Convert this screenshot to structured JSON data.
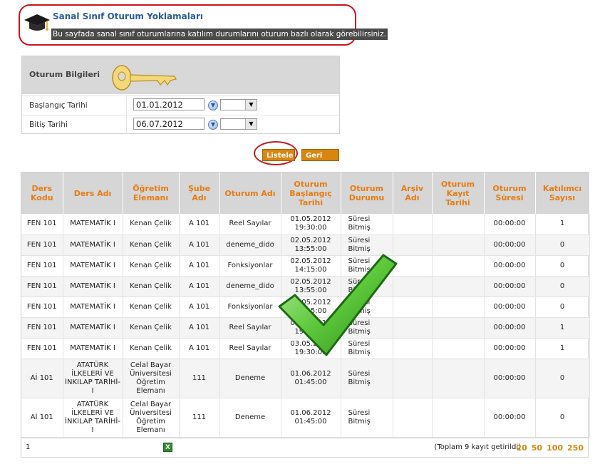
{
  "header": {
    "title": "Sanal Sınıf Oturum Yoklamaları",
    "description": "Bu sayfada sanal sınıf oturumlarına katılım durumlarını oturum bazlı olarak görebilirsiniz."
  },
  "form": {
    "title": "Oturum Bilgileri",
    "start_label": "Başlangıç Tarihi",
    "start_value": "01.01.2012",
    "end_label": "Bitiş Tarihi",
    "end_value": "06.07.2012"
  },
  "buttons": {
    "list": "Listele",
    "back": "Geri Dön"
  },
  "table": {
    "headers": [
      "Ders Kodu",
      "Ders Adı",
      "Öğretim Elemanı",
      "Şube Adı",
      "Oturum Adı",
      "Oturum Başlangıç Tarihi",
      "Oturum Durumu",
      "Arşiv Adı",
      "Oturum Kayıt Tarihi",
      "Oturum Süresi",
      "Katılımcı Sayısı"
    ],
    "rows": [
      {
        "code": "FEN 101",
        "course": "MATEMATİK I",
        "instructor": "Kenan Çelik",
        "branch": "A 101",
        "session": "Reel Sayılar",
        "start": "01.05.2012 19:30:00",
        "status": "Süresi Bitmiş",
        "archive": "",
        "record": "",
        "duration": "00:00:00",
        "count": "1"
      },
      {
        "code": "FEN 101",
        "course": "MATEMATİK I",
        "instructor": "Kenan Çelik",
        "branch": "A 101",
        "session": "deneme_dido",
        "start": "02.05.2012 13:55:00",
        "status": "Süresi Bitmiş",
        "archive": "",
        "record": "",
        "duration": "00:00:00",
        "count": "0"
      },
      {
        "code": "FEN 101",
        "course": "MATEMATİK I",
        "instructor": "Kenan Çelik",
        "branch": "A 101",
        "session": "Fonksiyonlar",
        "start": "02.05.2012 14:15:00",
        "status": "Süresi Bitmiş",
        "archive": "",
        "record": "",
        "duration": "00:00:00",
        "count": "0"
      },
      {
        "code": "FEN 101",
        "course": "MATEMATİK I",
        "instructor": "Kenan Çelik",
        "branch": "A 101",
        "session": "deneme_dido",
        "start": "02.05.2012 13:55:00",
        "status": "Süresi Bitmiş",
        "archive": "",
        "record": "",
        "duration": "00:00:00",
        "count": "0"
      },
      {
        "code": "FEN 101",
        "course": "MATEMATİK I",
        "instructor": "Kenan Çelik",
        "branch": "A 101",
        "session": "Fonksiyonlar",
        "start": "02.05.2012 14:15:00",
        "status": "Süresi Bitmiş",
        "archive": "",
        "record": "",
        "duration": "00:00:00",
        "count": "0"
      },
      {
        "code": "FEN 101",
        "course": "MATEMATİK I",
        "instructor": "Kenan Çelik",
        "branch": "A 101",
        "session": "Reel Sayılar",
        "start": "03.05.2012 19:30:00",
        "status": "Süresi Bitmiş",
        "archive": "",
        "record": "",
        "duration": "00:00:00",
        "count": "1"
      },
      {
        "code": "FEN 101",
        "course": "MATEMATİK I",
        "instructor": "Kenan Çelik",
        "branch": "A 101",
        "session": "Reel Sayılar",
        "start": "03.05.2012 19:30:00",
        "status": "Süresi Bitmiş",
        "archive": "",
        "record": "",
        "duration": "00:00:00",
        "count": "1"
      },
      {
        "code": "Aİ 101",
        "course": "ATATÜRK İLKELERİ VE İNKILAP TARİHİ-I",
        "instructor": "Celal Bayar Üniversitesi Öğretim Elemanı",
        "branch": "111",
        "session": "Deneme",
        "start": "01.06.2012 01:45:00",
        "status": "Süresi Bitmiş",
        "archive": "",
        "record": "",
        "duration": "00:00:00",
        "count": "0"
      },
      {
        "code": "Aİ 101",
        "course": "ATATÜRK İLKELERİ VE İNKILAP TARİHİ-I",
        "instructor": "Celal Bayar Üniversitesi Öğretim Elemanı",
        "branch": "111",
        "session": "Deneme",
        "start": "01.06.2012 01:45:00",
        "status": "Süresi Bitmiş",
        "archive": "",
        "record": "",
        "duration": "00:00:00",
        "count": "0"
      }
    ]
  },
  "footer": {
    "page": "1",
    "total": "(Toplam 9 kayıt getirildi)",
    "page_sizes": [
      "20",
      "50",
      "100",
      "250"
    ]
  },
  "icons": [
    "graduation-cap-icon",
    "key-icon",
    "calendar-icon",
    "excel-export-icon",
    "checkmark-icon"
  ],
  "colors": {
    "accent": "#d8860f",
    "header_text": "#e57c12",
    "title": "#2a5d9f",
    "highlight": "#c8161d"
  }
}
